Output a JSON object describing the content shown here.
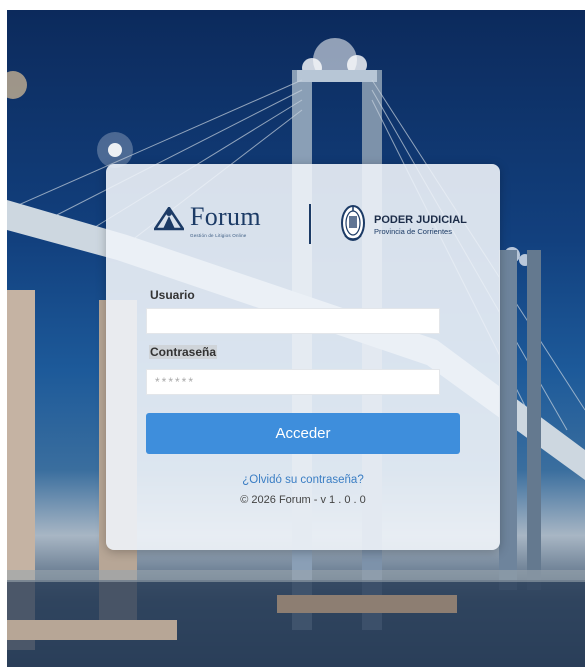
{
  "brand": {
    "forum_name": "Forum",
    "forum_tagline": "Gestión de Litigios Online",
    "institution_title": "PODER JUDICIAL",
    "institution_subtitle": "Provincia de Corrientes"
  },
  "form": {
    "user_label": "Usuario",
    "user_value": "",
    "password_label": "Contraseña",
    "password_placeholder": "******",
    "submit_label": "Acceder",
    "forgot_link": "¿Olvidó su contraseña?"
  },
  "footer": {
    "copyright": "© 2026 Forum - v 1 . 0 . 0"
  },
  "colors": {
    "accent": "#3e8edc",
    "link": "#3b7ec4",
    "brand_navy": "#1c3b66",
    "card_bg": "#eef3f8"
  },
  "icons": {
    "forum_logo": "people-triangle-icon",
    "institution_logo": "provincial-seal-icon"
  }
}
